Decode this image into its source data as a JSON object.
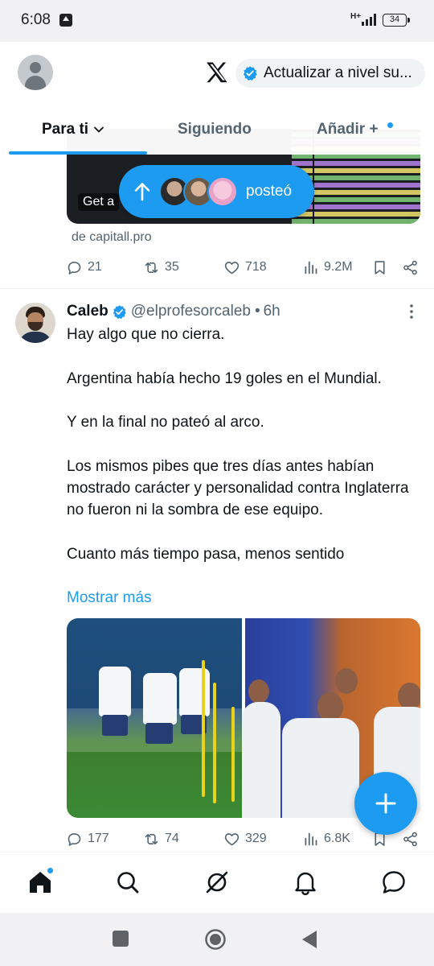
{
  "status_bar": {
    "time": "6:08",
    "network": "H+",
    "battery": "34"
  },
  "header": {
    "upgrade_label": "Actualizar a nivel su...",
    "tabs": [
      {
        "label": "Para ti",
        "active": true
      },
      {
        "label": "Siguiendo",
        "active": false
      },
      {
        "label": "Añadir +",
        "active": false
      }
    ]
  },
  "previous_tweet": {
    "card_text": "Get a",
    "source": "de capitall.pro",
    "actions": {
      "replies": "21",
      "reposts": "35",
      "likes": "718",
      "views": "9.2M"
    }
  },
  "posted_banner": {
    "label": "posteó"
  },
  "tweet": {
    "name": "Caleb",
    "handle": "@elprofesorcaleb",
    "separator": "•",
    "time": "6h",
    "paragraphs": [
      "Hay algo que no cierra.",
      "Argentina había hecho 19 goles en el Mundial.",
      "Y en la final no pateó al arco.",
      "Los mismos pibes que tres días antes habían mostrado carácter y personalidad contra Inglaterra no fueron ni la sombra de ese equipo.",
      "Cuanto más tiempo pasa, menos sentido"
    ],
    "show_more": "Mostrar más",
    "actions": {
      "replies": "177",
      "reposts": "74",
      "likes": "329",
      "views": "6.8K"
    }
  },
  "colors": {
    "accent": "#1d9bf0",
    "text_primary": "#0f1419",
    "text_secondary": "#536471"
  },
  "bottom_nav": [
    "home-icon",
    "search-icon",
    "grok-icon",
    "notifications-icon",
    "messages-icon"
  ]
}
